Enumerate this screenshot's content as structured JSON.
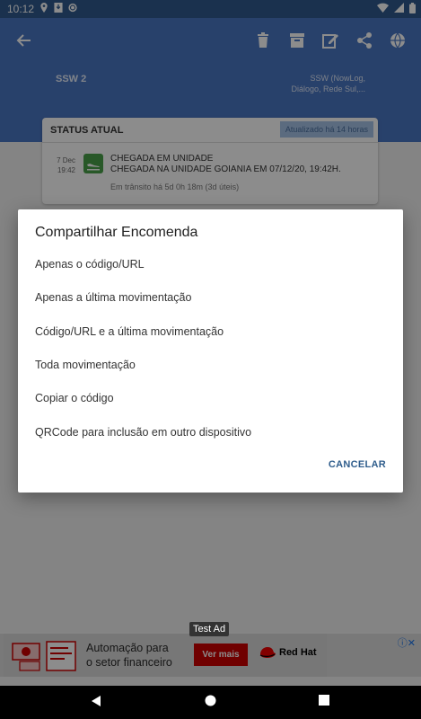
{
  "status_bar": {
    "time": "10:12",
    "left_icons": [
      "location-icon",
      "download-icon",
      "sync-icon"
    ],
    "right_icons": [
      "wifi-icon",
      "signal-icon",
      "battery-icon"
    ]
  },
  "toolbar": {
    "back_icon": "arrow-back-icon",
    "action_icons": [
      "delete-icon",
      "archive-icon",
      "edit-icon",
      "share-icon",
      "globe-icon"
    ]
  },
  "carrier": {
    "name": "SSW 2",
    "service_line1": "SSW (NowLog,",
    "service_line2": "Diálogo, Rede Sul,..."
  },
  "status_card": {
    "title": "STATUS ATUAL",
    "updated": "Atualizado há 14 horas",
    "event_date_day": "7 Dec",
    "event_date_time": "19:42",
    "event_title": "CHEGADA EM UNIDADE",
    "event_detail": "CHEGADA NA UNIDADE GOIANIA EM 07/12/20, 19:42H.",
    "transit": "Em trânsito há 5d 0h 18m (3d úteis)"
  },
  "dialog": {
    "title": "Compartilhar Encomenda",
    "options": [
      "Apenas o código/URL",
      "Apenas a última movimentação",
      "Código/URL e a última movimentação",
      "Toda movimentação",
      "Copiar o código",
      "QRCode para inclusão em outro dispositivo"
    ],
    "cancel_label": "CANCELAR"
  },
  "ad": {
    "label": "Test Ad",
    "text_line1": "Automação para",
    "text_line2": "o setor financeiro",
    "cta": "Ver mais",
    "brand": "Red Hat"
  },
  "colors": {
    "header": "#4a77c3",
    "status_bar": "#305a8f",
    "accent": "#2f5d8c",
    "event_icon": "#4aa04a",
    "ad_cta": "#cc0000"
  }
}
